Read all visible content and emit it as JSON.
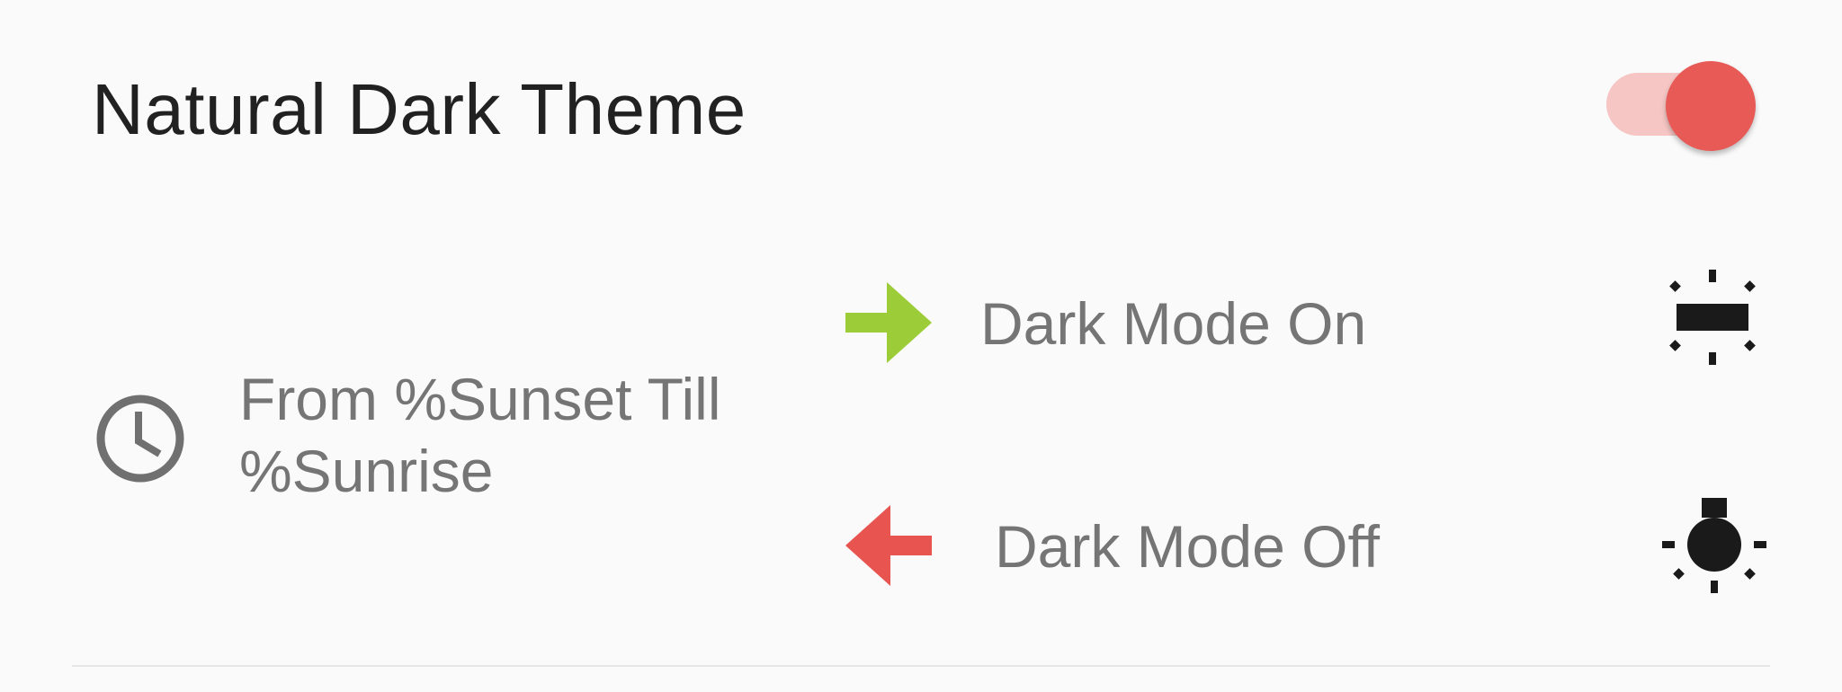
{
  "setting": {
    "title": "Natural Dark Theme",
    "toggle_on": true
  },
  "schedule": {
    "label": "From %Sunset Till %Sunrise",
    "icon": "clock-icon"
  },
  "modes": {
    "on": {
      "label": "Dark Mode On",
      "arrow_icon": "arrow-right-icon",
      "status_icon": "sunset-icon"
    },
    "off": {
      "label": "Dark Mode Off",
      "arrow_icon": "arrow-left-icon",
      "status_icon": "sunrise-icon"
    }
  },
  "colors": {
    "background": "#fafafa",
    "title_text": "#212121",
    "secondary_text": "#757575",
    "accent": "#e85a56",
    "accent_track": "#f5c6c4",
    "arrow_on": "#9ccc38",
    "arrow_off": "#e85550",
    "icon_dark": "#1a1a1a",
    "clock_gray": "#707070"
  }
}
